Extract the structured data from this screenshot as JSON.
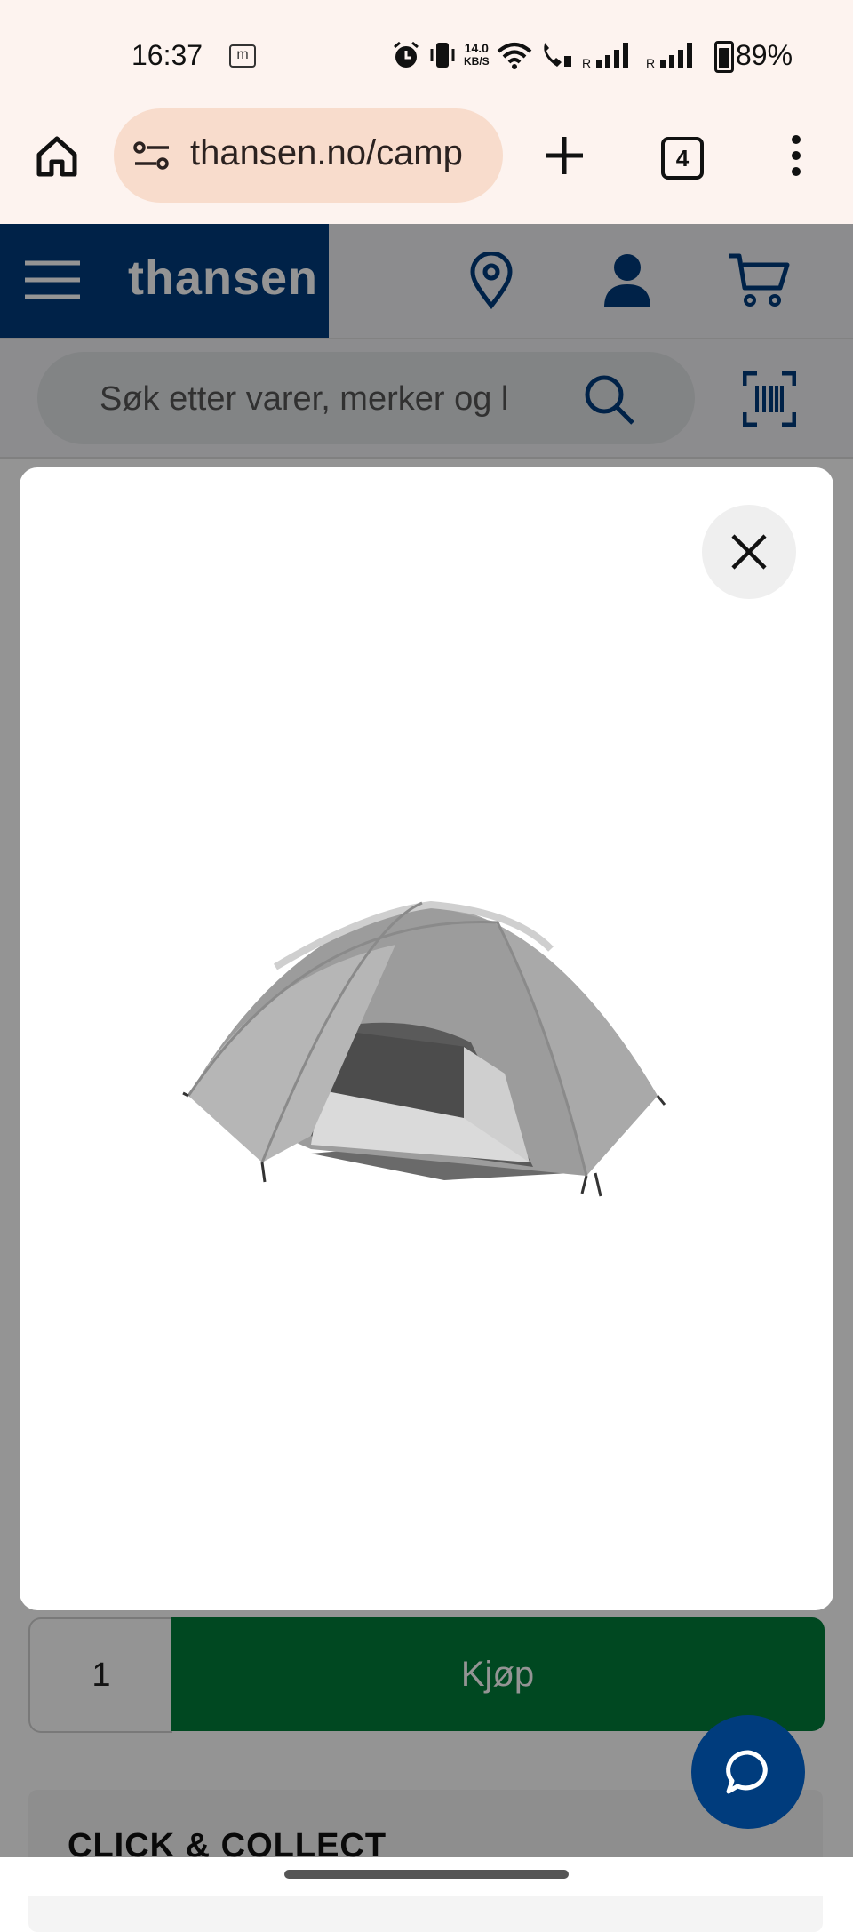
{
  "status_bar": {
    "time": "16:37",
    "notification": "m",
    "speed_value": "14.0",
    "speed_unit": "KB/S",
    "battery": "89%"
  },
  "browser": {
    "url": "thansen.no/camp",
    "tab_count": "4"
  },
  "site": {
    "logo": "thansen",
    "search_placeholder": "Søk etter varer, merker og l"
  },
  "product": {
    "quantity": "1",
    "buy_label": "Kjøp",
    "click_collect": "CLICK & COLLECT"
  },
  "modal": {
    "image_alt": "tent"
  }
}
